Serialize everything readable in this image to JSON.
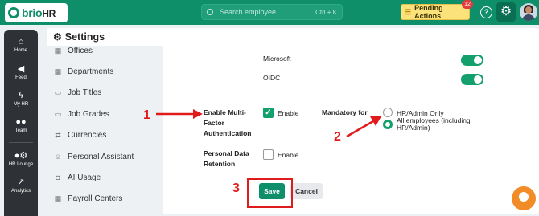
{
  "app": {
    "logo_text": "brio",
    "logo_suffix": "HR",
    "search_placeholder": "Search employee",
    "search_shortcut": "Ctrl + K",
    "pending_label": "Pending Actions",
    "pending_count": "12",
    "help_glyph": "?"
  },
  "nav": [
    {
      "label": "Home",
      "icon": "home-icon",
      "glyph": "⌂"
    },
    {
      "label": "Feed",
      "icon": "megaphone-icon",
      "glyph": "📢"
    },
    {
      "label": "My HR",
      "icon": "bolt-icon",
      "glyph": "ϟ"
    },
    {
      "label": "Team",
      "icon": "team-icon",
      "glyph": "👥"
    },
    {
      "label": "HR Lounge",
      "icon": "user-gear-icon",
      "glyph": "⚙"
    },
    {
      "label": "Analytics",
      "icon": "chart-icon",
      "glyph": "📈"
    }
  ],
  "page": {
    "title": "Settings"
  },
  "submenu": [
    {
      "label": "Offices",
      "icon": "building-icon",
      "glyph": "▦"
    },
    {
      "label": "Departments",
      "icon": "building-icon",
      "glyph": "▦"
    },
    {
      "label": "Job Titles",
      "icon": "briefcase-icon",
      "glyph": "▭"
    },
    {
      "label": "Job Grades",
      "icon": "briefcase-icon",
      "glyph": "▭"
    },
    {
      "label": "Currencies",
      "icon": "exchange-icon",
      "glyph": "⇄"
    },
    {
      "label": "Personal Assistant",
      "icon": "people-icon",
      "glyph": "☺"
    },
    {
      "label": "AI Usage",
      "icon": "robot-icon",
      "glyph": "◘"
    },
    {
      "label": "Payroll Centers",
      "icon": "building-icon",
      "glyph": "▦"
    }
  ],
  "sso": {
    "microsoft_label": "Microsoft",
    "microsoft_enabled": true,
    "oidc_label": "OIDC",
    "oidc_enabled": true
  },
  "mfa": {
    "label": "Enable Multi-Factor Authentication",
    "checkbox_label": "Enable",
    "checked": true,
    "mandatory_label": "Mandatory for",
    "options": [
      {
        "label": "HR/Admin Only",
        "selected": false
      },
      {
        "label": "All employees (including HR/Admin)",
        "selected": true
      }
    ]
  },
  "retention": {
    "label": "Personal Data Retention",
    "checkbox_label": "Enable",
    "checked": false
  },
  "actions": {
    "save_label": "Save",
    "cancel_label": "Cancel"
  },
  "annotations": {
    "n1": "1",
    "n2": "2",
    "n3": "3",
    "color": "#e01b1b"
  },
  "colors": {
    "brand": "#0f8e6a",
    "toggle_on": "#13a06c",
    "pending_bg": "#fbe27a"
  }
}
